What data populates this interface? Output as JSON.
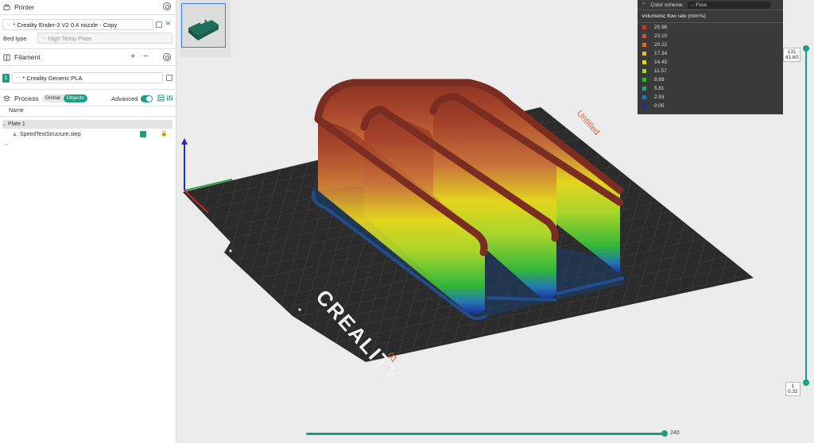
{
  "printer": {
    "title": "Printer",
    "preset": "* Creality Ender-3 V2 0.4 nozzle - Copy",
    "bed_type_label": "Bed type",
    "bed_type_value": "High Temp Plate"
  },
  "filament": {
    "title": "Filament",
    "slot": "1",
    "preset": "* Creality Generic PLA"
  },
  "process": {
    "title": "Process",
    "seg_global": "Global",
    "seg_objects": "Objects",
    "advanced_label": "Advanced"
  },
  "objects": {
    "column_name": "Name",
    "plate": "Plate 1",
    "object": "SpeedTestStructure.step"
  },
  "legend": {
    "scheme_label": "Color scheme",
    "scheme_value": "Flow",
    "title": "Volumetric flow rate (mm³/s)",
    "items": [
      {
        "value": "25.98",
        "color": "#c0392b"
      },
      {
        "value": "23.10",
        "color": "#c8553a"
      },
      {
        "value": "20.22",
        "color": "#c8743a"
      },
      {
        "value": "17.34",
        "color": "#d9c22a"
      },
      {
        "value": "14.45",
        "color": "#e4d51f"
      },
      {
        "value": "11.57",
        "color": "#a9d52a"
      },
      {
        "value": "8.69",
        "color": "#2fb63a"
      },
      {
        "value": "5.81",
        "color": "#2aa37a"
      },
      {
        "value": "2.93",
        "color": "#2477b3"
      },
      {
        "value": "0.05",
        "color": "#1c2f9c"
      }
    ]
  },
  "layer_slider": {
    "top_layer": "131",
    "top_height": "41.60",
    "bottom_layer": "1",
    "bottom_height": "0.32"
  },
  "move_slider": {
    "value": "240"
  },
  "bed": {
    "brand": "CREALITY",
    "plate_name": "Untitled",
    "plate_index": "01"
  },
  "accent": "#1f9c84"
}
